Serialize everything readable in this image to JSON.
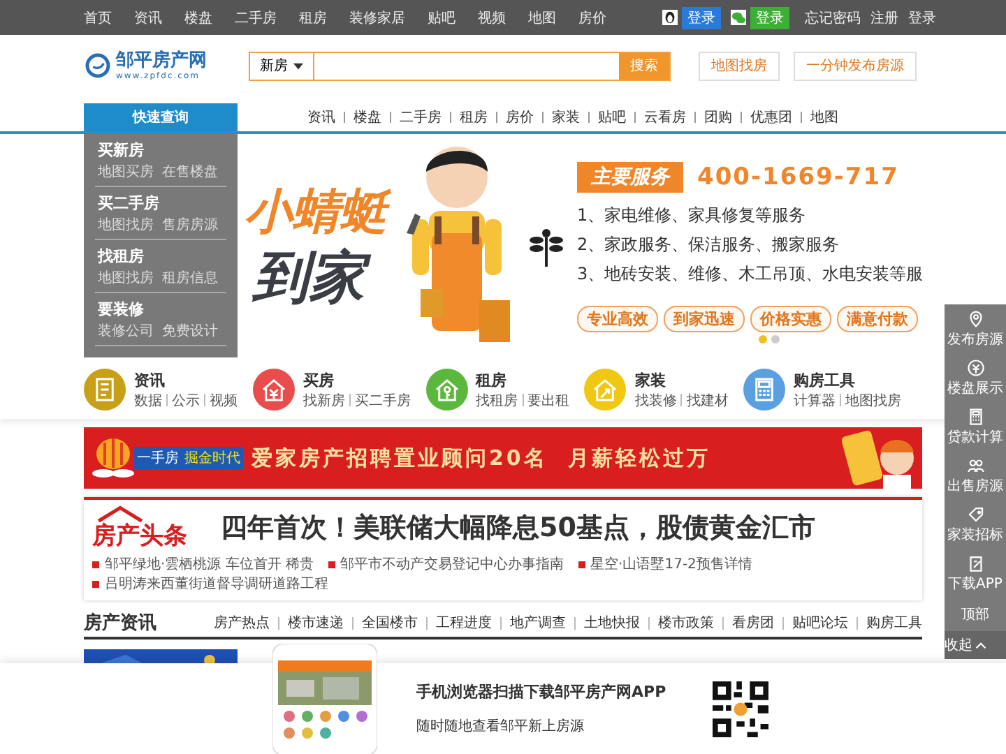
{
  "top_bar": {
    "links": [
      "首页",
      "资讯",
      "楼盘",
      "二手房",
      "租房",
      "装修家居",
      "贴吧",
      "视频",
      "地图",
      "房价"
    ],
    "qq_login": "登录",
    "wechat_login": "登录",
    "account_links": [
      "忘记密码",
      "注册",
      "登录"
    ]
  },
  "header": {
    "logo_name": "邹平房产网",
    "logo_url": "www.zpfdc.com",
    "search": {
      "category": "新房",
      "button": "搜索"
    },
    "buttons": [
      "地图找房",
      "一分钟发布房源"
    ]
  },
  "nav": {
    "quick": "快速查询",
    "links": [
      "资讯",
      "楼盘",
      "二手房",
      "租房",
      "房价",
      "家装",
      "贴吧",
      "云看房",
      "团购",
      "优惠团",
      "地图"
    ]
  },
  "quick_menu": [
    {
      "title": "买新房",
      "links": [
        "地图买房",
        "在售楼盘"
      ]
    },
    {
      "title": "买二手房",
      "links": [
        "地图找房",
        "售房房源"
      ]
    },
    {
      "title": "找租房",
      "links": [
        "地图找房",
        "租房信息"
      ]
    },
    {
      "title": "要装修",
      "links": [
        "装修公司",
        "免费设计"
      ]
    }
  ],
  "banner": {
    "slogan_1": "小蜻蜓",
    "slogan_2": "到家",
    "service_label": "主要服务",
    "phone": "400-1669-717",
    "services": [
      "1、家电维修、家具修复等服务",
      "2、家政服务、保洁服务、搬家服务",
      "3、地砖安装、维修、木工吊顶、水电安装等服"
    ],
    "tags": [
      "专业高效",
      "到家迅速",
      "价格实惠",
      "满意付款"
    ],
    "dots": [
      {
        "selected": true
      },
      {
        "selected": false
      }
    ]
  },
  "categories": [
    {
      "title": "资讯",
      "links": [
        "数据",
        "公示",
        "视频"
      ],
      "color": "#c8a018"
    },
    {
      "title": "买房",
      "links": [
        "找新房",
        "买二手房"
      ],
      "color": "#e84c4c"
    },
    {
      "title": "租房",
      "links": [
        "找租房",
        "要出租"
      ],
      "color": "#5cb83c"
    },
    {
      "title": "家装",
      "links": [
        "找装修",
        "找建材"
      ],
      "color": "#f0c814"
    },
    {
      "title": "购房工具",
      "links": [
        "计算器",
        "地图找房"
      ],
      "color": "#5aa0e0"
    }
  ],
  "ad_banner": {
    "badge_1": "一手房",
    "badge_2": "掘金时代",
    "text": "爱家房产招聘置业顾问20名  月薪轻松过万"
  },
  "headline": {
    "logo": "房产头条",
    "title": "四年首次！美联储大幅降息50基点，股债黄金汇市",
    "news": [
      "邹平绿地·雲栖桃源 车位首开 稀贵",
      "邹平市不动产交易登记中心办事指南",
      "星空·山语墅17-2预售详情",
      "吕明涛来西董街道督导调研道路工程"
    ]
  },
  "news_section": {
    "title": "房产资讯",
    "tabs": [
      "房产热点",
      "楼市速递",
      "全国楼市",
      "工程进度",
      "地产调查",
      "土地快报",
      "楼市政策",
      "看房团",
      "贴吧论坛",
      "购房工具"
    ]
  },
  "side_bar": [
    {
      "kind": "icon",
      "label": "发布房源"
    },
    {
      "kind": "icon",
      "label": "楼盘展示"
    },
    {
      "kind": "icon",
      "label": "贷款计算"
    },
    {
      "kind": "icon",
      "label": "出售房源"
    },
    {
      "kind": "icon",
      "label": "家装招标"
    },
    {
      "kind": "icon",
      "label": "下载APP"
    },
    {
      "kind": "text",
      "label": "顶部"
    },
    {
      "kind": "collapse",
      "label": "收起"
    }
  ],
  "app_promo": {
    "title": "手机浏览器扫描下载邹平房产网APP",
    "subtitle": "随时随地查看邹平新上房源"
  }
}
